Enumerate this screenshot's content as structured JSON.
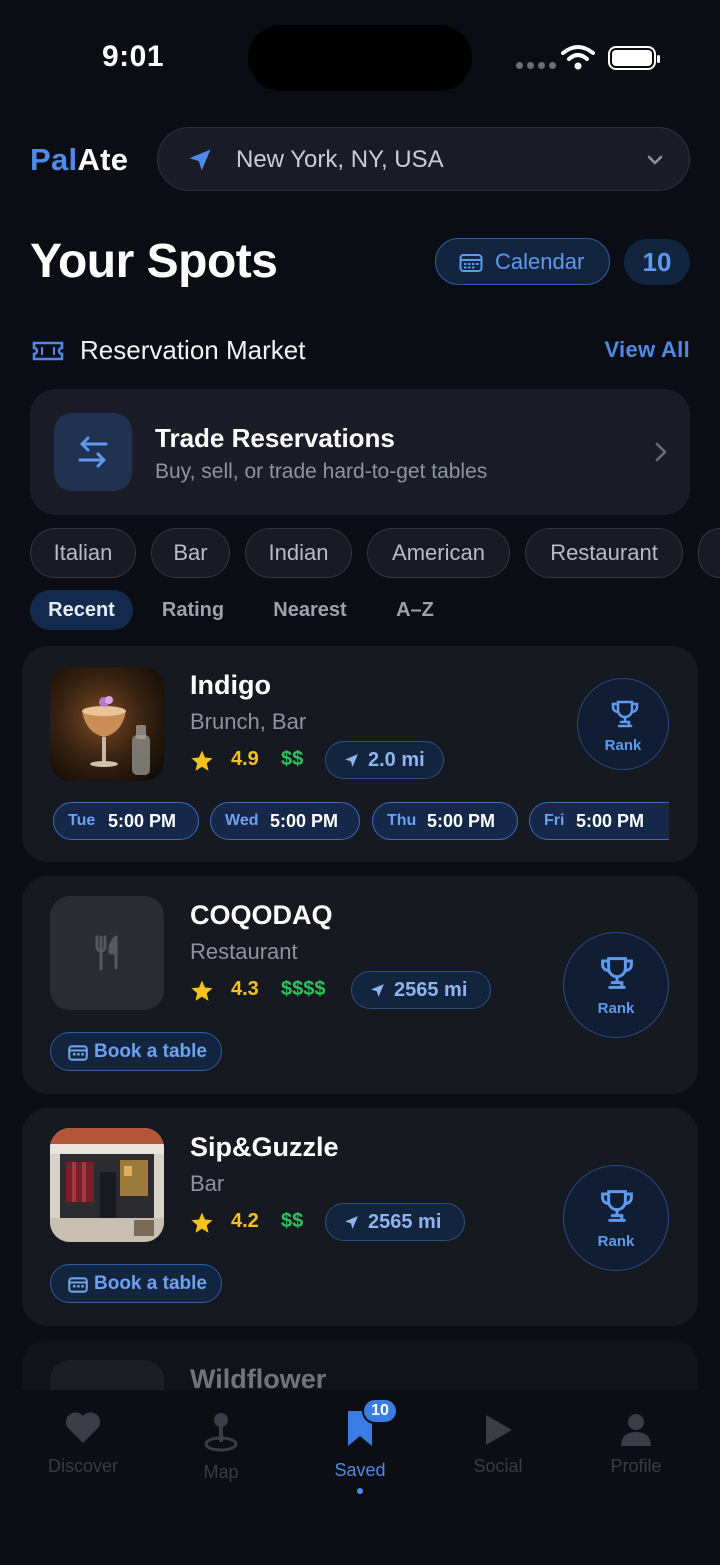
{
  "status": {
    "time": "9:01"
  },
  "header": {
    "logo_part1": "Pal",
    "logo_part2": "Ate",
    "location": "New York, NY, USA"
  },
  "page": {
    "title": "Your Spots",
    "calendar_label": "Calendar",
    "count": "10"
  },
  "reservation_market": {
    "label": "Reservation Market",
    "view_all": "View All",
    "trade_title": "Trade Reservations",
    "trade_subtitle": "Buy, sell, or trade hard-to-get tables"
  },
  "cuisine_filters": [
    "Italian",
    "Bar",
    "Indian",
    "American",
    "Restaurant"
  ],
  "sort_options": [
    "Recent",
    "Rating",
    "Nearest",
    "A–Z"
  ],
  "sort_active": "Recent",
  "spots": [
    {
      "name": "Indigo",
      "category": "Brunch, Bar",
      "rating": "4.9",
      "price": "$$",
      "distance": "2.0 mi",
      "rank_label": "Rank",
      "times": [
        {
          "day": "Tue",
          "time": "5:00 PM"
        },
        {
          "day": "Wed",
          "time": "5:00 PM"
        },
        {
          "day": "Thu",
          "time": "5:00 PM"
        },
        {
          "day": "Fri",
          "time": "5:00 PM"
        }
      ]
    },
    {
      "name": "COQODAQ",
      "category": "Restaurant",
      "rating": "4.3",
      "price": "$$$$",
      "distance": "2565 mi",
      "rank_label": "Rank",
      "book_label": "Book a table"
    },
    {
      "name": "Sip&Guzzle",
      "category": "Bar",
      "rating": "4.2",
      "price": "$$",
      "distance": "2565 mi",
      "rank_label": "Rank",
      "book_label": "Book a table"
    },
    {
      "name": "Wildflower"
    }
  ],
  "tabbar": {
    "tabs": [
      "Discover",
      "Map",
      "Saved",
      "Social",
      "Profile"
    ],
    "active": "Saved",
    "saved_badge": "10"
  },
  "colors": {
    "accent": "#4f8ae8",
    "background": "#0b0d14",
    "card": "#171921",
    "rating_star": "#f4c21d",
    "price_green": "#2fc25c"
  }
}
